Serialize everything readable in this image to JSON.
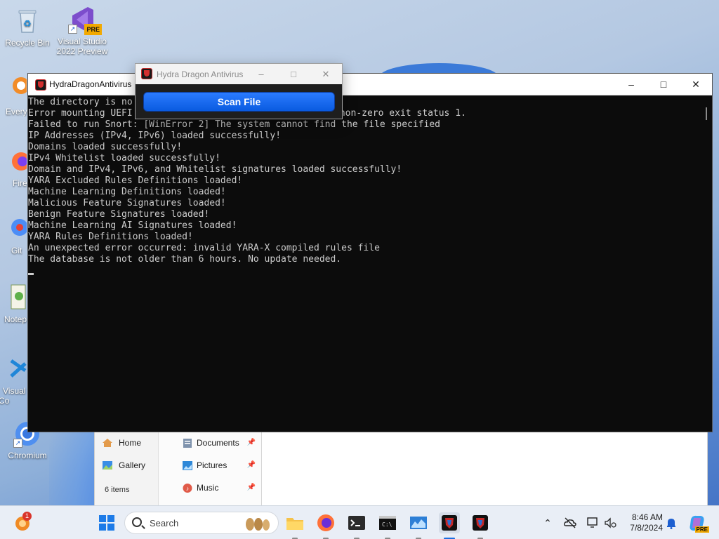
{
  "desktop": {
    "icons": [
      {
        "label": "Recycle Bin"
      },
      {
        "label": "Visual Studio 2022 Preview",
        "badge": "PRE"
      },
      {
        "label": "Every"
      },
      {
        "label": "Fire"
      },
      {
        "label": "Git"
      },
      {
        "label": "Notep"
      },
      {
        "label": "Visual Co"
      },
      {
        "label": "Chromium"
      }
    ]
  },
  "explorer": {
    "nav": [
      {
        "label": "Home"
      },
      {
        "label": "Gallery"
      }
    ],
    "quick_access": [
      {
        "label": "Documents"
      },
      {
        "label": "Pictures"
      },
      {
        "label": "Music"
      }
    ],
    "status": "6 items"
  },
  "terminal": {
    "title": "HydraDragonAntivirus",
    "lines": [
      "The directory is no",
      "Error mounting UEFI",
      "Failed to run Snort: [WinError 2] The system cannot find the file specified",
      "IP Addresses (IPv4, IPv6) loaded successfully!",
      "Domains loaded successfully!",
      "IPv4 Whitelist loaded successfully!",
      "Domain and IPv4, IPv6, and Whitelist signatures loaded successfully!",
      "YARA Excluded Rules Definitions loaded!",
      "Machine Learning Definitions loaded!",
      "Malicious Feature Signatures loaded!",
      "Benign Feature Signatures loaded!",
      "Machine Learning AI Signatures loaded!",
      "YARA Rules Definitions loaded!",
      "An unexpected error occurred: invalid YARA-X compiled rules file",
      "The database is not older than 6 hours. No update needed."
    ],
    "line2_tail": "rned non-zero exit status 1."
  },
  "scanner": {
    "title": "Hydra Dragon Antivirus",
    "scan_button": "Scan File"
  },
  "window_controls": {
    "minimize": "–",
    "maximize": "□",
    "close": "✕"
  },
  "taskbar": {
    "search_label": "Search",
    "time": "8:46 AM",
    "date": "7/8/2024",
    "notification_count": "1",
    "copilot_badge": "PRE"
  },
  "colors": {
    "terminal_bg": "#0c0c0c",
    "terminal_text": "#cccccc",
    "scan_button": "#1a6bf0",
    "taskbar_bg": "#e9eef6"
  }
}
